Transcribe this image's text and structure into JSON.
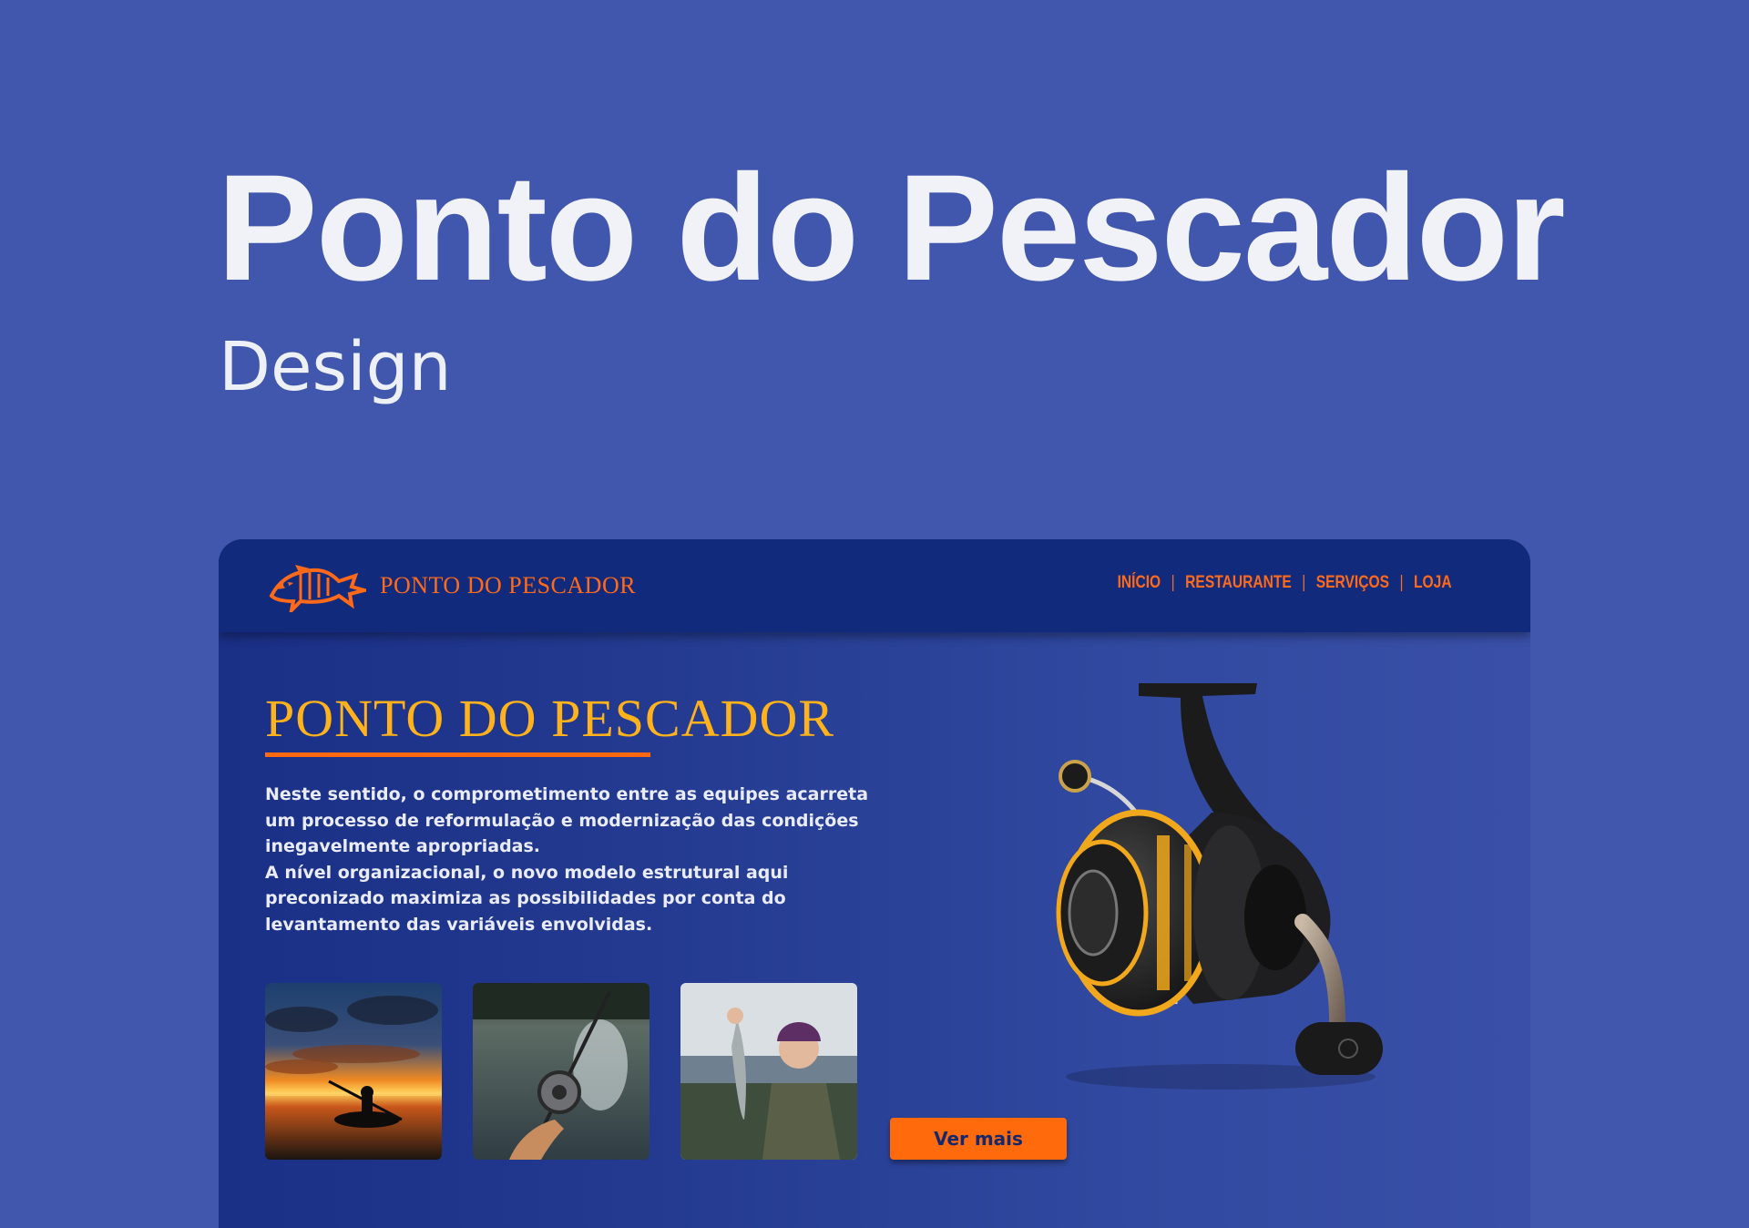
{
  "project": {
    "title": "Ponto do Pescador",
    "subtitle": "Design"
  },
  "site": {
    "brand": "PONTO DO PESCADOR",
    "nav": [
      "INÍCIO",
      "RESTAURANTE",
      "SERVIÇOS",
      "LOJA"
    ],
    "nav_separator": "|",
    "hero_title": "PONTO DO PESCADOR",
    "hero_paragraph_1": "Neste sentido, o comprometimento entre as equipes acarreta um processo de reformulação e modernização das condições inegavelmente apropriadas.",
    "hero_paragraph_2": "A nível organizacional, o novo modelo estrutural aqui preconizado maximiza as possibilidades por conta do levantamento das variáveis envolvidas.",
    "cta_label": "Ver mais"
  },
  "colors": {
    "page_background": "#4157ad",
    "header_background": "#122a7c",
    "accent_orange": "#ff6a1a",
    "title_yellow": "#ffb21c",
    "text_light": "#e9ecf6"
  },
  "icons": [
    "fish-skeleton-logo-icon",
    "fishing-reel-image",
    "sunset-kayak-photo",
    "fishing-reel-water-photo",
    "fisherman-holding-fish-photo"
  ]
}
